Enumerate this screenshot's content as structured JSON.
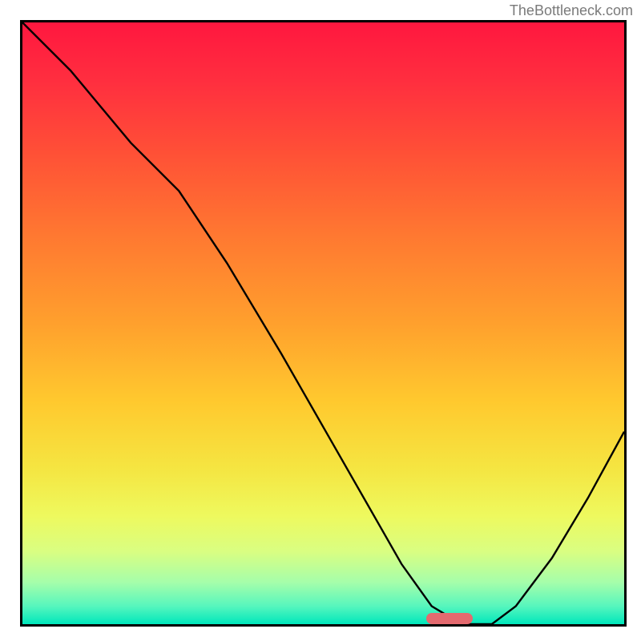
{
  "attribution": "TheBottleneck.com",
  "chart_data": {
    "type": "line",
    "title": "",
    "xlabel": "",
    "ylabel": "",
    "xlim": [
      0,
      100
    ],
    "ylim": [
      0,
      100
    ],
    "grid": false,
    "background": "red-to-green vertical gradient",
    "series": [
      {
        "name": "curve",
        "x": [
          0,
          8,
          18,
          26,
          34,
          43,
          51,
          59,
          63,
          68,
          73,
          78,
          82,
          88,
          94,
          100
        ],
        "y": [
          100,
          92,
          80,
          72,
          60,
          45,
          31,
          17,
          10,
          3,
          0,
          0,
          3,
          11,
          21,
          32
        ]
      }
    ],
    "marker": {
      "x": 71,
      "y": 0,
      "width_pct": 7.7,
      "color": "#e46a6f"
    }
  }
}
